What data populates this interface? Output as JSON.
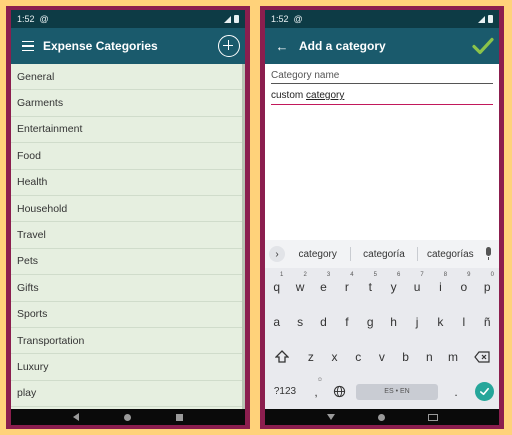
{
  "left_screen": {
    "status": {
      "time": "1:52",
      "at_icon": "@"
    },
    "appbar": {
      "title": "Expense Categories"
    },
    "categories": [
      "General",
      "Garments",
      "Entertainment",
      "Food",
      "Health",
      "Household",
      "Travel",
      "Pets",
      "Gifts",
      "Sports",
      "Transportation",
      "Luxury",
      "play"
    ]
  },
  "right_screen": {
    "status": {
      "time": "1:52",
      "at_icon": "@"
    },
    "appbar": {
      "title": "Add a category"
    },
    "field": {
      "label": "Category name",
      "value_prefix": "custom ",
      "value_underlined": "category"
    },
    "suggestions": [
      "category",
      "categoría",
      "categorías"
    ],
    "keyboard": {
      "row1": [
        {
          "k": "q",
          "n": "1"
        },
        {
          "k": "w",
          "n": "2"
        },
        {
          "k": "e",
          "n": "3"
        },
        {
          "k": "r",
          "n": "4"
        },
        {
          "k": "t",
          "n": "5"
        },
        {
          "k": "y",
          "n": "6"
        },
        {
          "k": "u",
          "n": "7"
        },
        {
          "k": "i",
          "n": "8"
        },
        {
          "k": "o",
          "n": "9"
        },
        {
          "k": "p",
          "n": "0"
        }
      ],
      "row2": [
        "a",
        "s",
        "d",
        "f",
        "g",
        "h",
        "j",
        "k",
        "l",
        "ñ"
      ],
      "row3": [
        "z",
        "x",
        "c",
        "v",
        "b",
        "n",
        "m"
      ],
      "symbols_label": "?123",
      "comma": ",",
      "comma_emoji": "☺",
      "space_label": "ES • EN",
      "period": "."
    }
  },
  "colors": {
    "appbar": "#1a5a6c",
    "statusbar": "#0d3b45",
    "list_bg": "#e6efe0",
    "accent": "#c2185b",
    "check": "#8bc34a",
    "enter": "#26a69a",
    "frame": "#8b1e4e",
    "background": "#ffd27a"
  }
}
